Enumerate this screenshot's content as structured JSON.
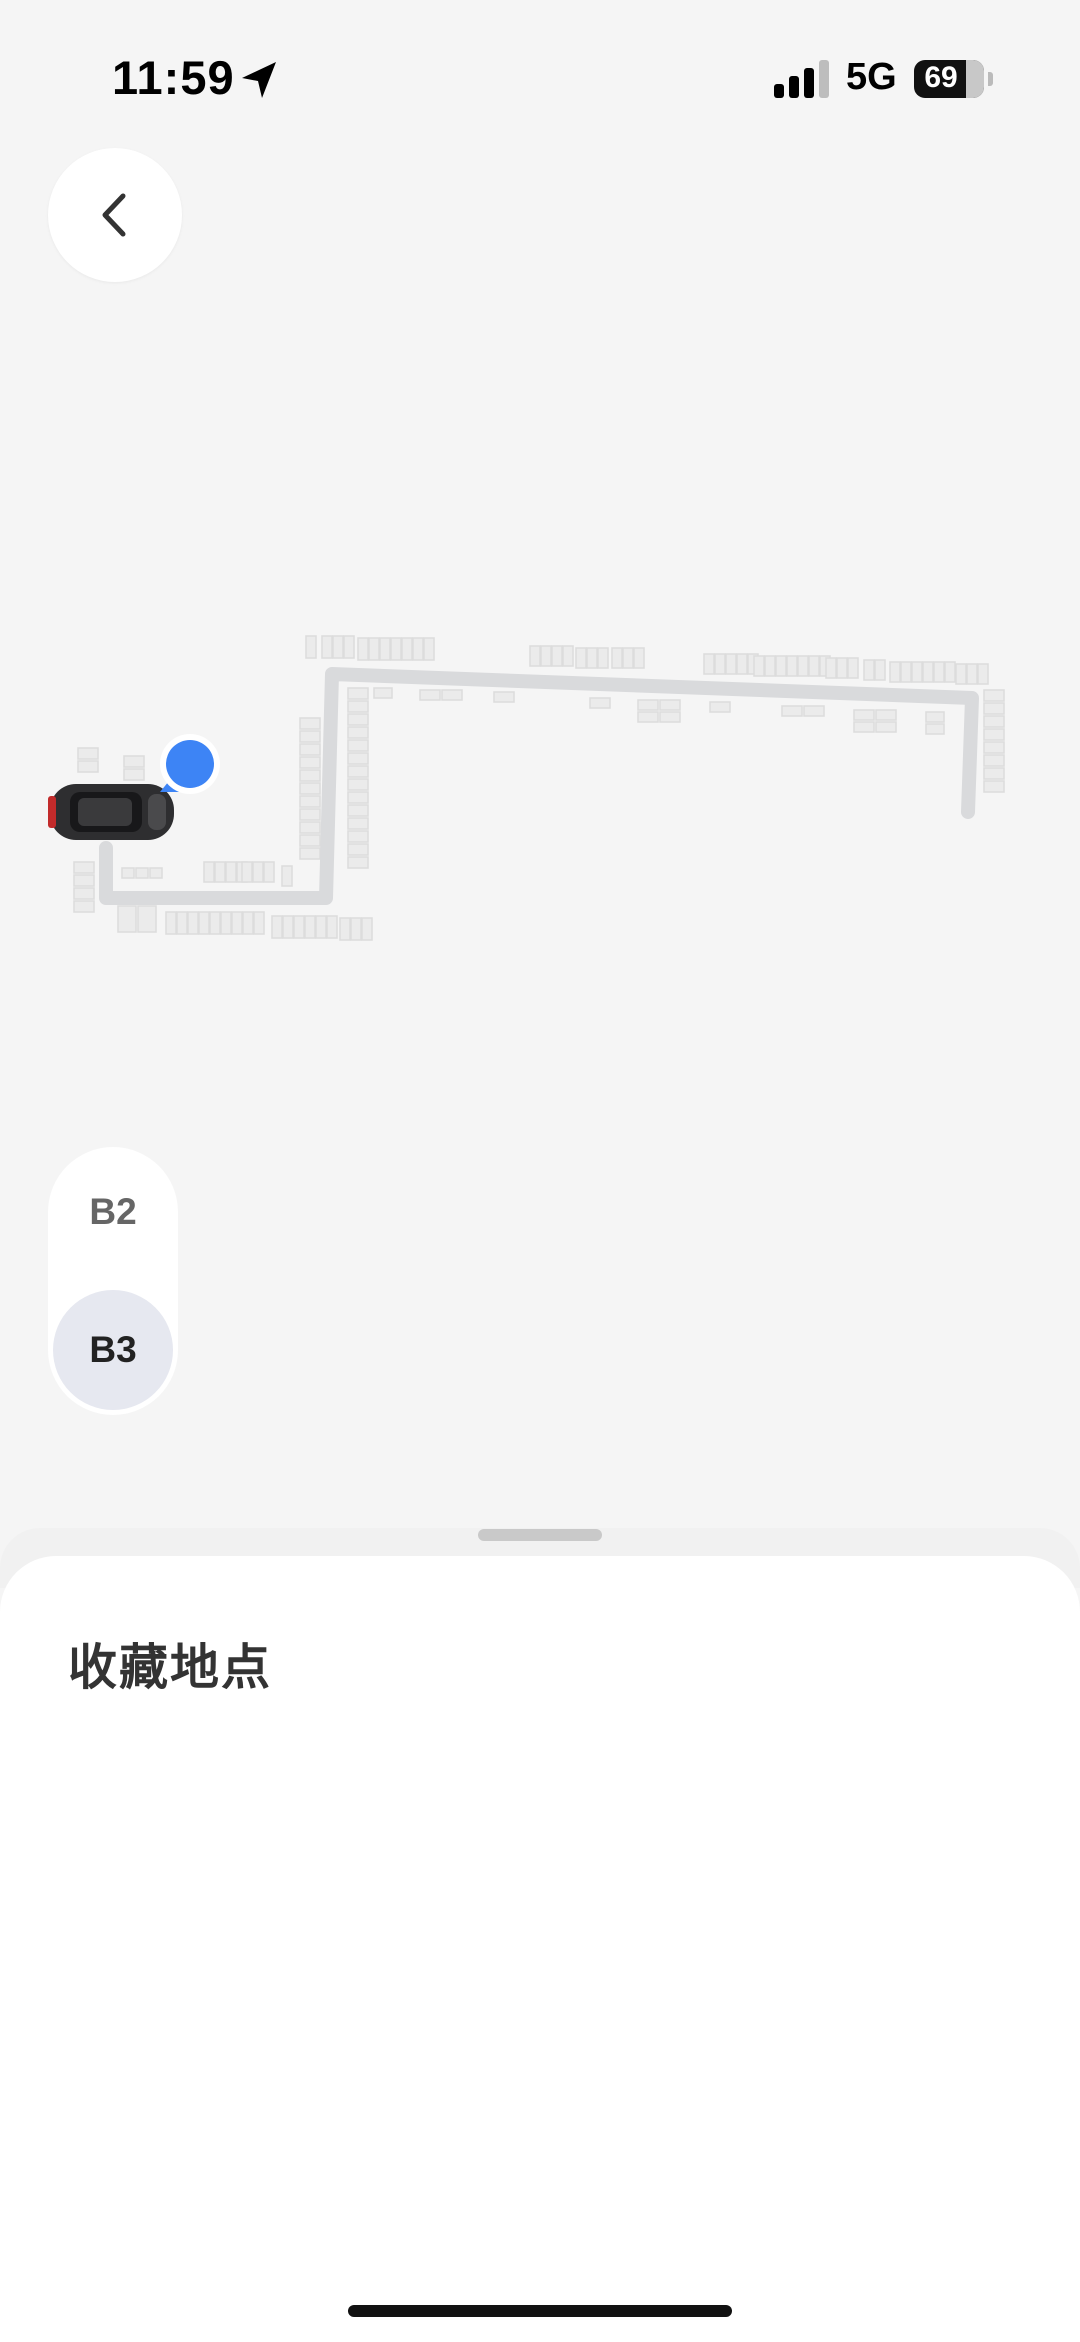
{
  "status_bar": {
    "time": "11:59",
    "network": "5G",
    "battery": "69"
  },
  "floors": {
    "items": [
      {
        "label": "B2",
        "selected": false
      },
      {
        "label": "B3",
        "selected": true
      }
    ]
  },
  "sheet": {
    "title": "收藏地点"
  },
  "colors": {
    "location_dot": "#3d84f5",
    "route": "#d9dadc",
    "parking_slot": "#e8e8e8",
    "map_background": "#f5f5f5"
  },
  "icons": {
    "back": "chevron-left-icon",
    "location_services": "navigation-arrow-icon",
    "signal": "cellular-signal-icon",
    "battery": "battery-icon",
    "vehicle": "car-icon",
    "current_location": "location-dot-icon"
  }
}
